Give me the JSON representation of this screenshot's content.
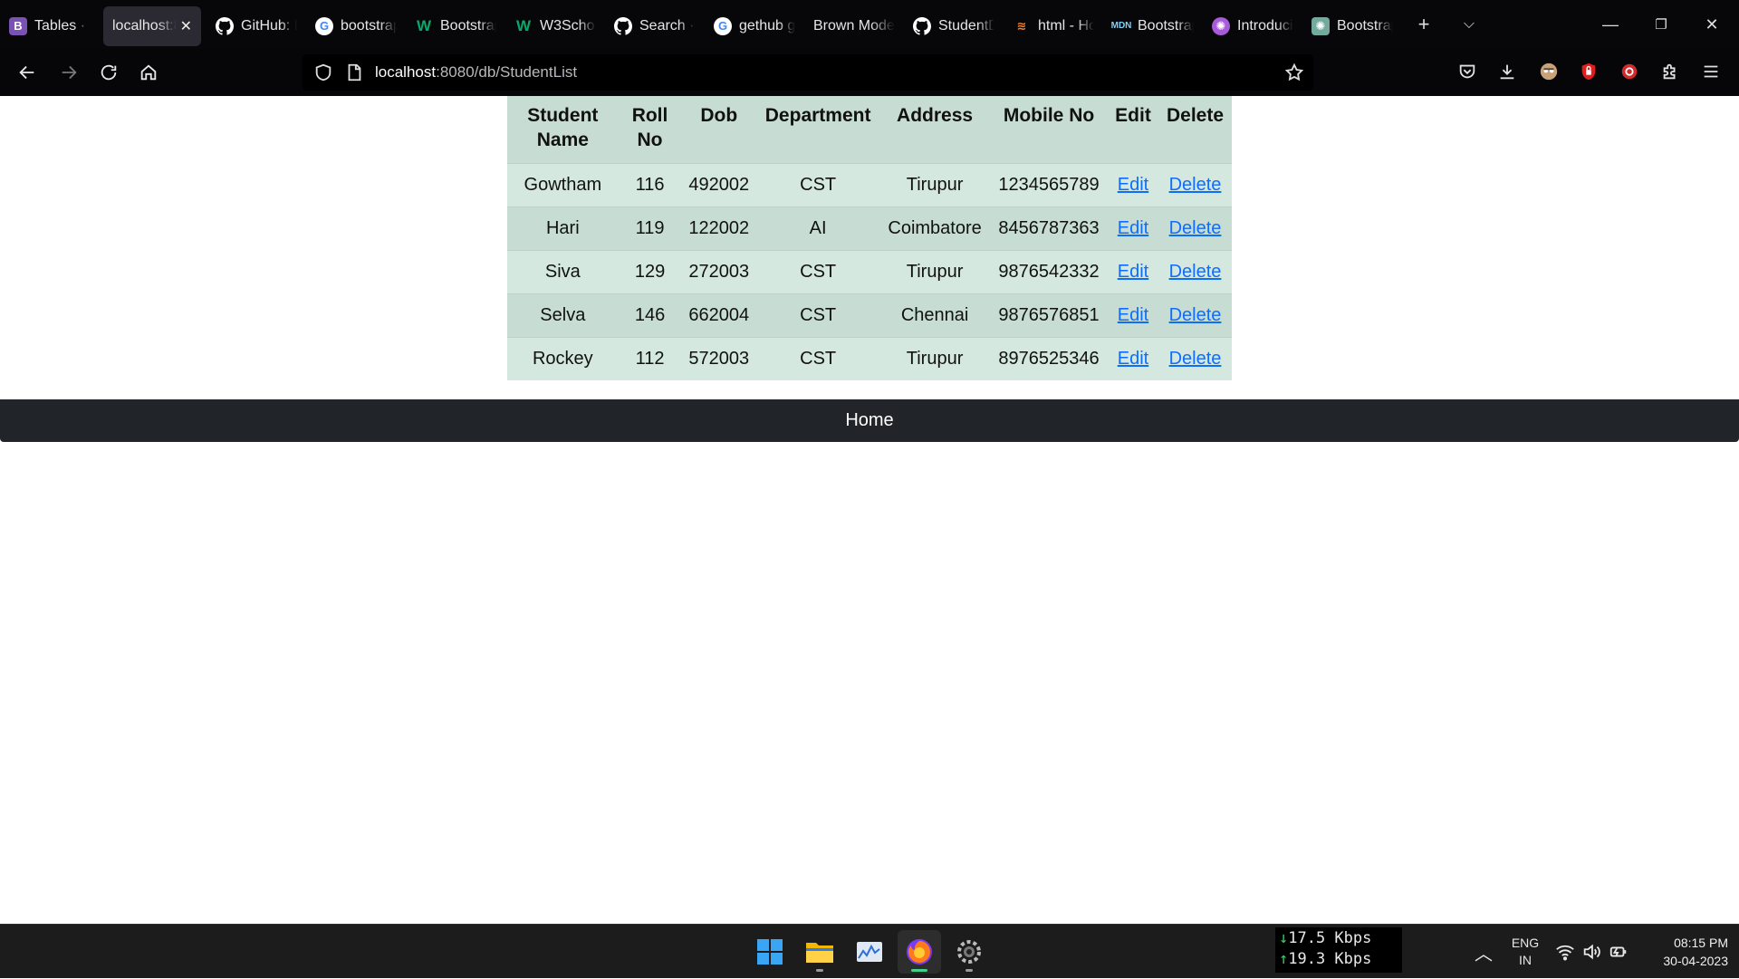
{
  "browser": {
    "tabs": [
      {
        "label": "Tables · B",
        "icon": "bootstrap-icon",
        "active": false
      },
      {
        "label": "localhost:8",
        "icon": "",
        "active": true
      },
      {
        "label": "GitHub: L",
        "icon": "github-icon",
        "active": false
      },
      {
        "label": "bootstrap",
        "icon": "google-icon",
        "active": false
      },
      {
        "label": "Bootstrap",
        "icon": "w3schools-icon",
        "active": false
      },
      {
        "label": "W3Schoo",
        "icon": "w3schools-icon",
        "active": false
      },
      {
        "label": "Search · l",
        "icon": "github-icon",
        "active": false
      },
      {
        "label": "gethub g",
        "icon": "google-icon",
        "active": false
      },
      {
        "label": "Brown Mode",
        "icon": "",
        "active": false
      },
      {
        "label": "StudentD",
        "icon": "github-icon",
        "active": false
      },
      {
        "label": "html - Ho",
        "icon": "stackoverflow-icon",
        "active": false
      },
      {
        "label": "Bootstrap",
        "icon": "mdn-icon",
        "active": false
      },
      {
        "label": "Introducin",
        "icon": "openai-icon",
        "active": false
      },
      {
        "label": "Bootstrap",
        "icon": "chatgpt-icon",
        "active": false
      }
    ],
    "url_host": "localhost",
    "url_path": ":8080/db/StudentList"
  },
  "table": {
    "headers": {
      "name": "Student Name",
      "roll": "Roll No",
      "dob": "Dob",
      "dept": "Department",
      "address": "Address",
      "mobile": "Mobile No",
      "edit": "Edit",
      "delete": "Delete"
    },
    "rows": [
      {
        "name": "Gowtham",
        "roll": "116",
        "dob": "492002",
        "dept": "CST",
        "address": "Tirupur",
        "mobile": "1234565789",
        "edit": "Edit",
        "delete": "Delete"
      },
      {
        "name": "Hari",
        "roll": "119",
        "dob": "122002",
        "dept": "AI",
        "address": "Coimbatore",
        "mobile": "8456787363",
        "edit": "Edit",
        "delete": "Delete"
      },
      {
        "name": "Siva",
        "roll": "129",
        "dob": "272003",
        "dept": "CST",
        "address": "Tirupur",
        "mobile": "9876542332",
        "edit": "Edit",
        "delete": "Delete"
      },
      {
        "name": "Selva",
        "roll": "146",
        "dob": "662004",
        "dept": "CST",
        "address": "Chennai",
        "mobile": "9876576851",
        "edit": "Edit",
        "delete": "Delete"
      },
      {
        "name": "Rockey",
        "roll": "112",
        "dob": "572003",
        "dept": "CST",
        "address": "Tirupur",
        "mobile": "8976525346",
        "edit": "Edit",
        "delete": "Delete"
      }
    ]
  },
  "footer": {
    "home_label": "Home"
  },
  "taskbar": {
    "net_down": "17.5 Kbps",
    "net_up": "19.3 Kbps",
    "lang_top": "ENG",
    "lang_bottom": "IN",
    "time": "08:15 PM",
    "date": "30-04-2023"
  },
  "colors": {
    "table_header_bg": "#c7ddd4",
    "table_row_odd": "#d4e8df",
    "link": "#0d6efd",
    "home_bar_bg": "#212529"
  }
}
